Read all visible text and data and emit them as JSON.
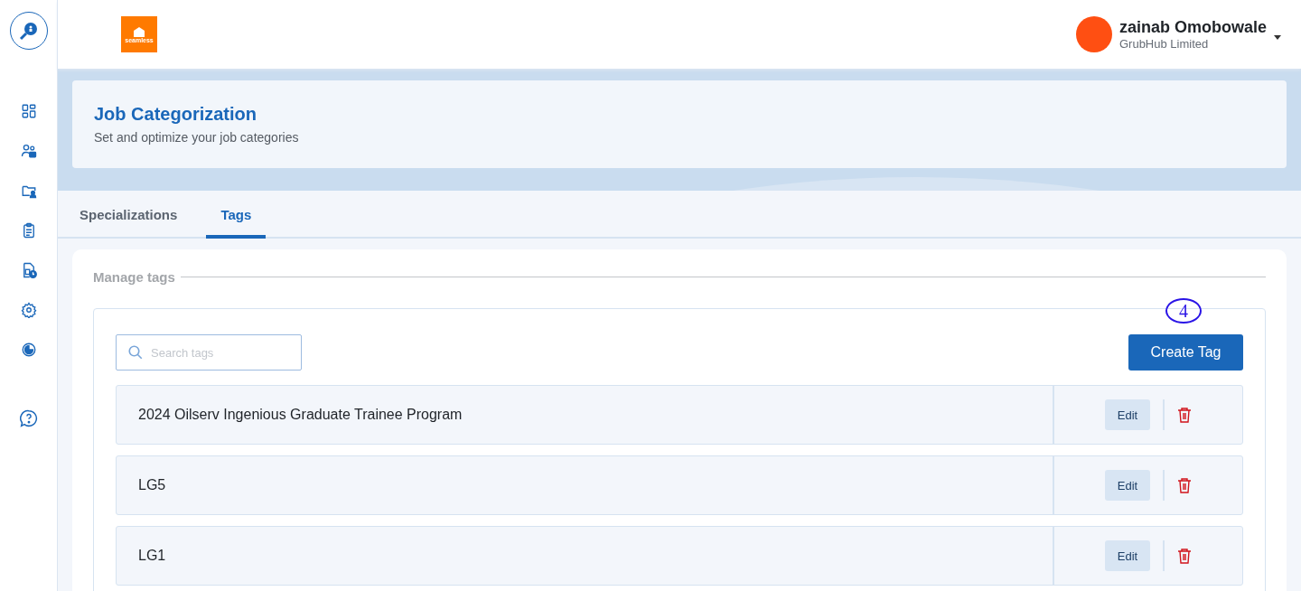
{
  "sidebar": {
    "items": [
      {
        "selected": false
      },
      {
        "selected": false
      },
      {
        "selected": false
      },
      {
        "selected": false
      },
      {
        "selected": false
      },
      {
        "selected": false
      },
      {
        "selected": false
      }
    ]
  },
  "header": {
    "logo": "seamless",
    "user_name": "zainab Omobowale",
    "company": "GrubHub Limited"
  },
  "banner": {
    "title": "Job Categorization",
    "subtitle": "Set and optimize your job categories"
  },
  "tabs": [
    {
      "label": "Specializations",
      "selected": false
    },
    {
      "label": "Tags",
      "selected": true
    }
  ],
  "panel": {
    "heading": "Manage tags",
    "search": {
      "placeholder": "Search tags"
    },
    "create_button": "Create Tag",
    "annotation": "4",
    "rows": [
      {
        "name": "2024 Oilserv Ingenious Graduate Trainee Program",
        "edit": "Edit"
      },
      {
        "name": "LG5",
        "edit": "Edit"
      },
      {
        "name": "LG1",
        "edit": "Edit"
      }
    ]
  }
}
